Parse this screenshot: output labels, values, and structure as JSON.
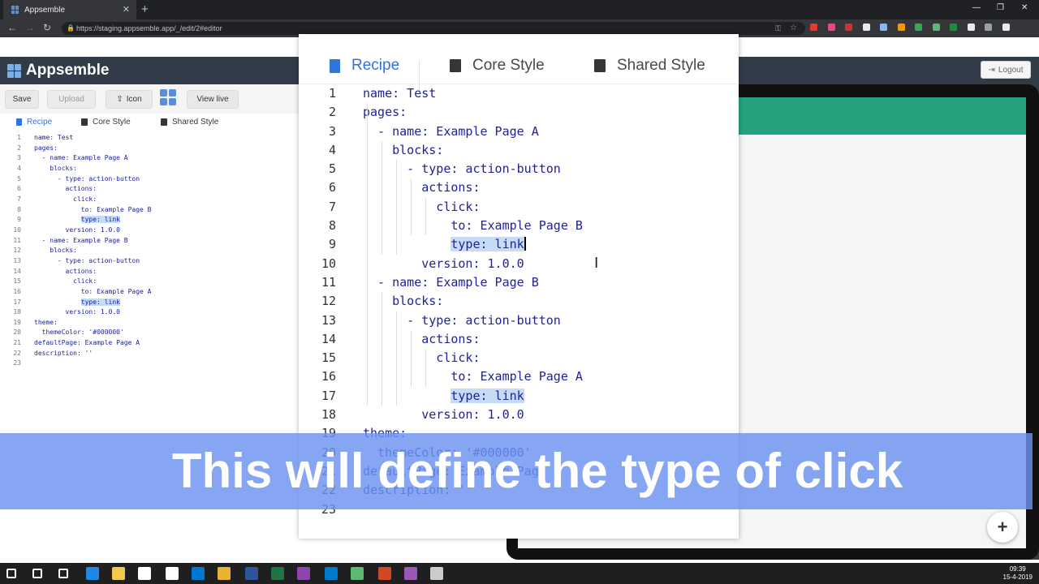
{
  "browser": {
    "tab_title": "Appsemble",
    "tab_close": "✕",
    "new_tab": "+",
    "url": "https://staging.appsemble.app/_/edit/2#editor",
    "window_controls": [
      "—",
      "❐",
      "✕"
    ],
    "extension_colors": [
      "#e33b2e",
      "#e8497a",
      "#d93025",
      "#e8eaed",
      "#8ab4f8",
      "#f29900",
      "#34a853",
      "#5bb974",
      "#1e8e3e",
      "#e8eaed",
      "#9aa0a6",
      "#e8eaed"
    ]
  },
  "app": {
    "name": "Appsemble",
    "toolbar": {
      "save": "Save",
      "upload": "Upload",
      "icon": "Icon",
      "view_live": "View live"
    },
    "tabs": {
      "recipe": "Recipe",
      "core_style": "Core Style",
      "shared_style": "Shared Style"
    },
    "logout": "Logout",
    "fab": "+"
  },
  "editor": {
    "lines": [
      "name: Test",
      "pages:",
      "  - name: Example Page A",
      "    blocks:",
      "      - type: action-button",
      "        actions:",
      "          click:",
      "            to: Example Page B",
      "            type: link",
      "        version: 1.0.0",
      "  - name: Example Page B",
      "    blocks:",
      "      - type: action-button",
      "        actions:",
      "          click:",
      "            to: Example Page A",
      "            type: link",
      "        version: 1.0.0",
      "theme:",
      "  themeColor: '#000000'",
      "defaultPage: Example Page A",
      "description: ''",
      ""
    ],
    "highlight_lines": [
      9,
      17
    ]
  },
  "subtitle": "This will define the type of click",
  "taskbar": {
    "time": "09:39",
    "date": "15-4-2019",
    "icon_colors": [
      "#ffffff",
      "#ffffff",
      "#ffffff",
      "#1e88e5",
      "#f2c94c",
      "#ffffff",
      "#ffffff",
      "#0078d4",
      "#e8b234",
      "#2b579a",
      "#217346",
      "#8e44ad",
      "#007acc",
      "#5bb974",
      "#d24726",
      "#9b59b6",
      "#cccccc"
    ]
  }
}
